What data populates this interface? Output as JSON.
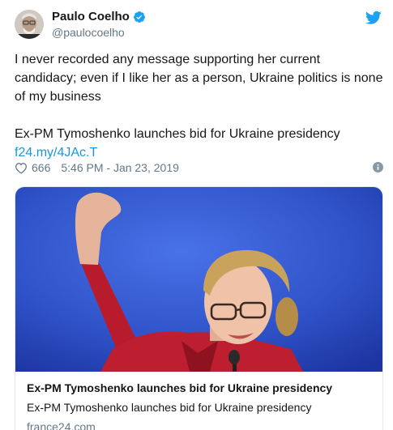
{
  "author": {
    "display_name": "Paulo Coelho",
    "handle": "@paulocoelho",
    "verified": true
  },
  "tweet": {
    "text_line1": "I never recorded any message supporting her current",
    "text_line2": "candidacy; even if I like her as a person, Ukraine politics is none",
    "text_line3": "of my business",
    "quote_headline": "Ex-PM Tymoshenko launches bid for Ukraine presidency",
    "short_link": "f24.my/4JAc.T"
  },
  "meta": {
    "likes": "666",
    "timestamp": "5:46 PM - Jan 23, 2019"
  },
  "card": {
    "title": "Ex-PM Tymoshenko launches bid for Ukraine presidency",
    "description": "Ex-PM Tymoshenko launches bid for Ukraine presidency",
    "domain": "france24.com"
  },
  "icons": {
    "verified": "verified-badge-icon",
    "brand": "twitter-bird-icon",
    "like": "heart-icon",
    "info": "info-icon"
  },
  "colors": {
    "link": "#1b95e0",
    "muted": "#657786",
    "verified": "#1da1f2",
    "card_bg": "#2f52c8"
  }
}
